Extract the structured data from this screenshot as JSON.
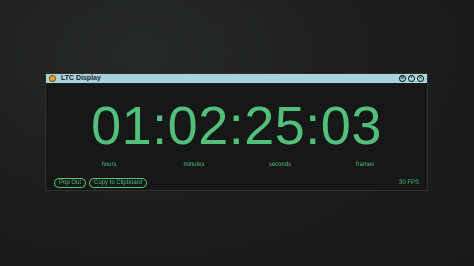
{
  "window": {
    "title": "LTC Display"
  },
  "timecode": {
    "display": "01:02:25:03",
    "labels": {
      "hours": "hours",
      "minutes": "minutes",
      "seconds": "seconds",
      "frames": "frames"
    }
  },
  "footer": {
    "pop_out_label": "Pop Out",
    "copy_label": "Copy to Clipboard",
    "fps": "30 FPS"
  },
  "colors": {
    "accent": "#52c07a",
    "titlebar": "#a7d3dc",
    "title_dot": "#f7a01d"
  },
  "icons": [
    "app-status-icon",
    "settings-icon",
    "pin-icon",
    "close-icon"
  ]
}
